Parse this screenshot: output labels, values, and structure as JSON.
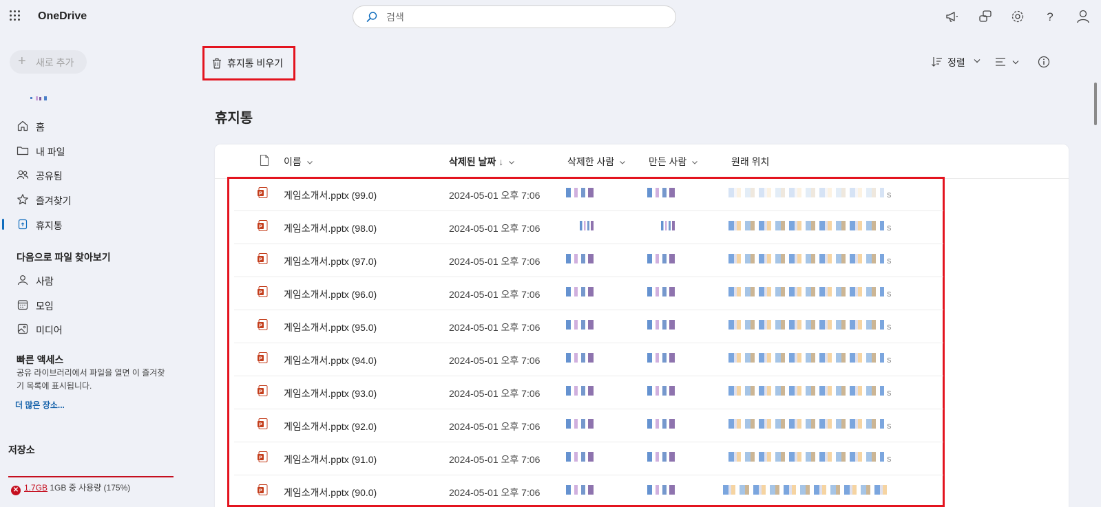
{
  "app": {
    "name": "OneDrive"
  },
  "search": {
    "placeholder": "검색"
  },
  "sidebar": {
    "new_label": "새로 추가",
    "nav": [
      {
        "label": "홈",
        "icon": "home-icon"
      },
      {
        "label": "내 파일",
        "icon": "folder-icon"
      },
      {
        "label": "공유됨",
        "icon": "people-icon"
      },
      {
        "label": "즐겨찾기",
        "icon": "star-icon"
      },
      {
        "label": "휴지통",
        "icon": "recycle-bin-icon",
        "active": true
      }
    ],
    "browse_title": "다음으로 파일 찾아보기",
    "browse": [
      {
        "label": "사람",
        "icon": "person-icon"
      },
      {
        "label": "모임",
        "icon": "calendar-icon"
      },
      {
        "label": "미디어",
        "icon": "image-icon"
      }
    ],
    "quick_title": "빠른 액세스",
    "quick_desc": "공유 라이브러리에서 파일을 열면 이 즐겨찾기 목록에 표시됩니다.",
    "more_link": "더 많은 장소...",
    "storage_title": "저장소",
    "storage_used": "1.7GB",
    "storage_rest": "1GB 중 사용량 (175%)"
  },
  "toolbar": {
    "empty_label": "휴지통 비우기",
    "sort_label": "정렬"
  },
  "page": {
    "title": "휴지통"
  },
  "table": {
    "columns": {
      "name": "이름",
      "deleted_date": "삭제된 날짜",
      "deleted_date_sort": "↓",
      "deleted_by": "삭제한 사람",
      "created_by": "만든 사람",
      "original_location": "원래 위치"
    },
    "rows": [
      {
        "name": "게임소개서.pptx (99.0)",
        "date": "2024-05-01 오후 7:06"
      },
      {
        "name": "게임소개서.pptx (98.0)",
        "date": "2024-05-01 오후 7:06"
      },
      {
        "name": "게임소개서.pptx (97.0)",
        "date": "2024-05-01 오후 7:06"
      },
      {
        "name": "게임소개서.pptx (96.0)",
        "date": "2024-05-01 오후 7:06"
      },
      {
        "name": "게임소개서.pptx (95.0)",
        "date": "2024-05-01 오후 7:06"
      },
      {
        "name": "게임소개서.pptx (94.0)",
        "date": "2024-05-01 오후 7:06"
      },
      {
        "name": "게임소개서.pptx (93.0)",
        "date": "2024-05-01 오후 7:06"
      },
      {
        "name": "게임소개서.pptx (92.0)",
        "date": "2024-05-01 오후 7:06"
      },
      {
        "name": "게임소개서.pptx (91.0)",
        "date": "2024-05-01 오후 7:06"
      },
      {
        "name": "게임소개서.pptx (90.0)",
        "date": "2024-05-01 오후 7:06"
      }
    ]
  },
  "colors": {
    "accent": "#0f6cbd",
    "highlight": "#e3141f",
    "error": "#c50f1f",
    "ppt": "#c43e1c"
  }
}
